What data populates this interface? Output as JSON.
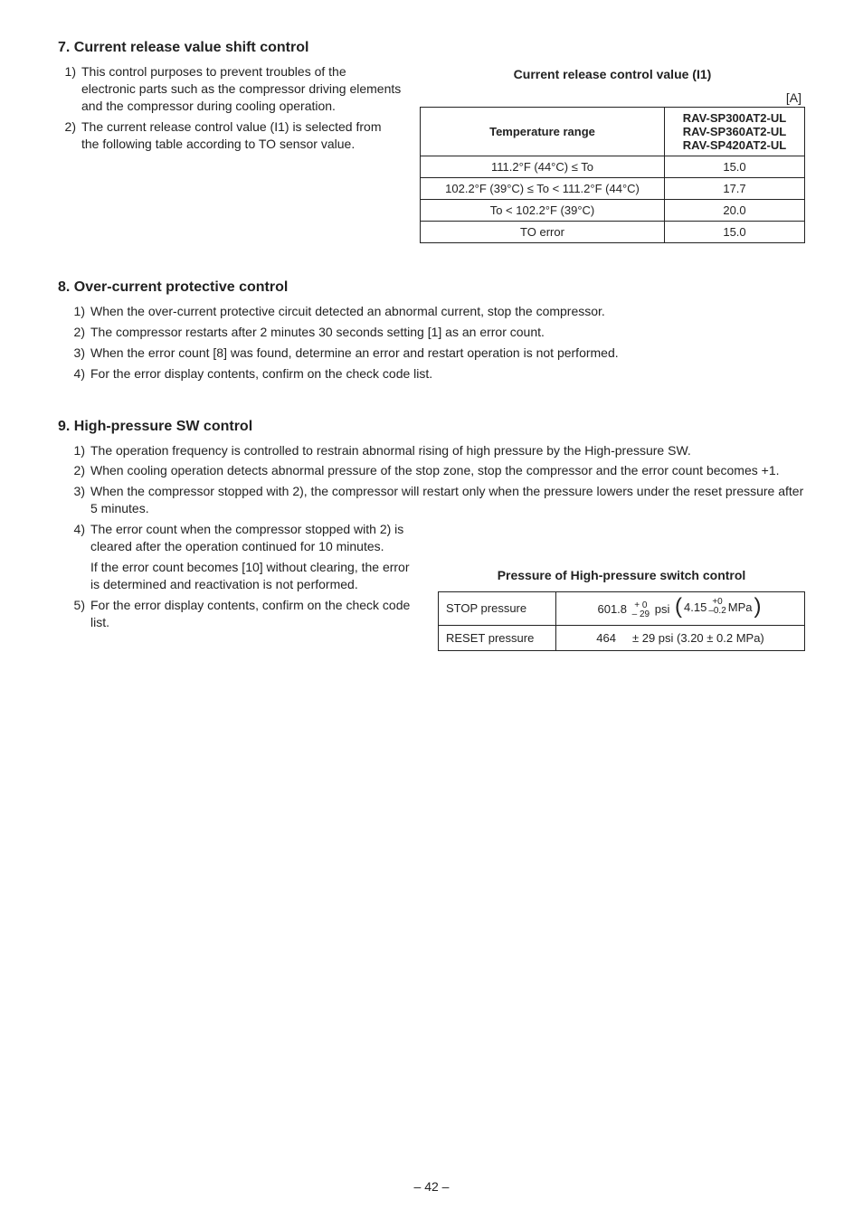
{
  "s7": {
    "title": "7. Current release value shift control",
    "items": [
      {
        "n": "1)",
        "t": "This control purposes to prevent troubles of the electronic parts such as the compressor driving elements and the compressor during cooling operation."
      },
      {
        "n": "2)",
        "t": "The current release control value (I1) is selected from the following table according to TO sensor value."
      }
    ],
    "table_title": "Current release control value (I1)",
    "unit": "[A]",
    "headers": {
      "col1": "Temperature range",
      "col2_l1": "RAV-SP300AT2-UL",
      "col2_l2": "RAV-SP360AT2-UL",
      "col2_l3": "RAV-SP420AT2-UL"
    },
    "rows": [
      {
        "range": "111.2°F (44°C) ≤ To",
        "val": "15.0"
      },
      {
        "range": "102.2°F (39°C) ≤ To < 111.2°F (44°C)",
        "val": "17.7"
      },
      {
        "range": "To < 102.2°F (39°C)",
        "val": "20.0"
      },
      {
        "range": "TO error",
        "val": "15.0"
      }
    ]
  },
  "s8": {
    "title": "8. Over-current protective control",
    "items": [
      {
        "n": "1)",
        "t": "When the over-current protective circuit detected an abnormal current, stop the compressor."
      },
      {
        "n": "2)",
        "t": "The compressor restarts after 2 minutes 30 seconds setting [1] as an error count."
      },
      {
        "n": "3)",
        "t": "When the error count [8] was found, determine an error and restart operation is not performed."
      },
      {
        "n": "4)",
        "t": "For the error display contents, confirm on the check code list."
      }
    ]
  },
  "s9": {
    "title": "9. High-pressure SW control",
    "items": [
      {
        "n": "1)",
        "t": "The operation frequency is controlled to restrain abnormal rising of high pressure by the High-pressure SW."
      },
      {
        "n": "2)",
        "t": "When cooling operation detects abnormal pressure of the stop zone, stop the compressor and the error count becomes +1."
      },
      {
        "n": "3)",
        "t": "When the compressor stopped with 2), the compressor will restart only when the pressure lowers under the reset pressure after 5 minutes."
      }
    ],
    "items_left": [
      {
        "n": "4)",
        "t": "The error count when the compressor stopped with 2) is cleared after the operation continued for 10 minutes.",
        "t2": "If the error count becomes [10] without clearing, the error is determined and reactivation is not performed."
      },
      {
        "n": "5)",
        "t": "For the error display contents, confirm on the check code list."
      }
    ],
    "ptitle": "Pressure of High-pressure switch control",
    "p_stop_label": "STOP pressure",
    "p_stop_main": "601.8",
    "p_stop_t1": "+ 0",
    "p_stop_t2": "– 29",
    "p_stop_unit1": "psi",
    "p_stop_paren_main": "4.15",
    "p_stop_paren_t1": "+0",
    "p_stop_paren_t2": "–0.2",
    "p_stop_unit2": "MPa",
    "p_reset_label": "RESET pressure",
    "p_reset_val": "464     ± 29 psi (3.20 ± 0.2 MPa)"
  },
  "pagenum": "– 42 –"
}
